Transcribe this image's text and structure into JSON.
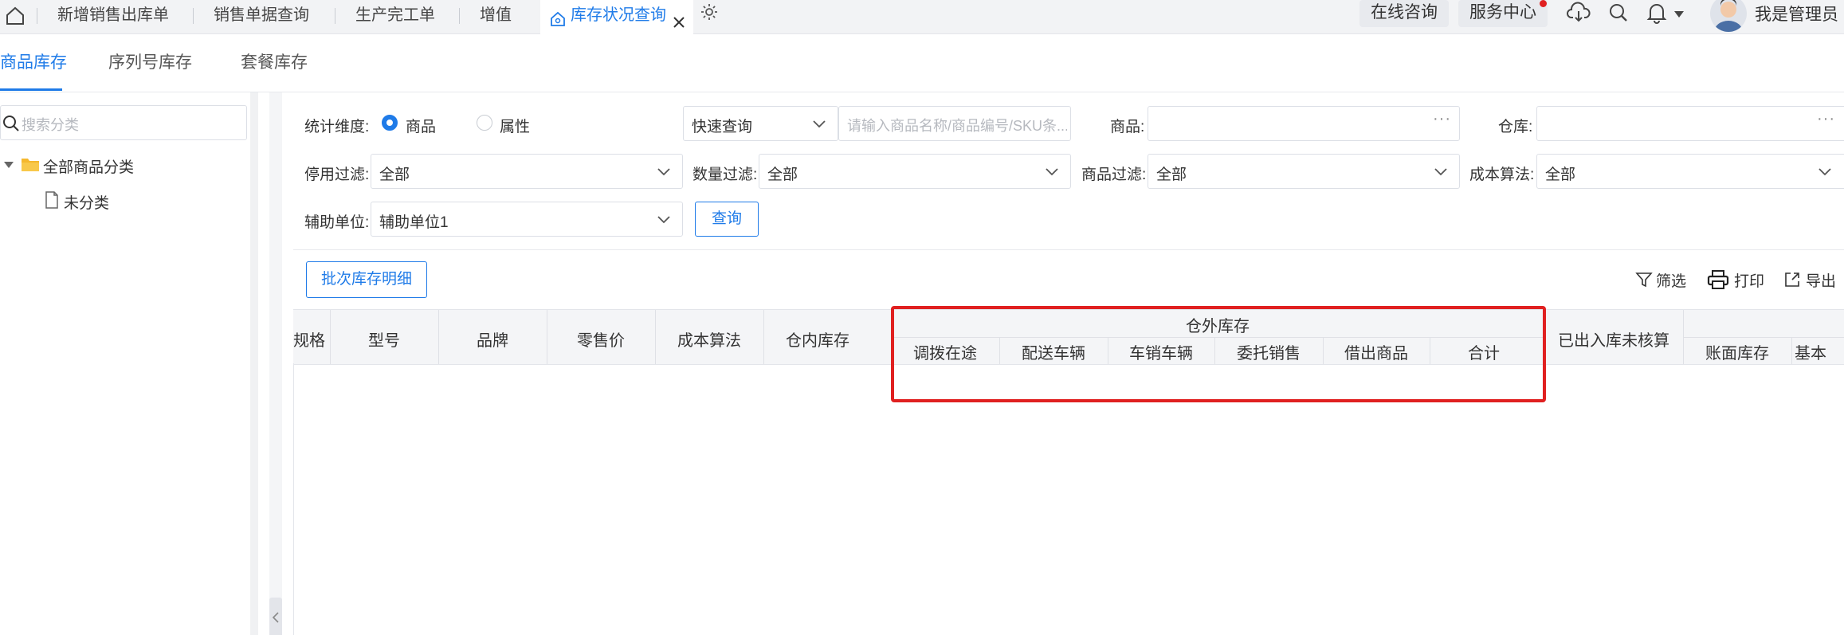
{
  "top_tabs": [
    {
      "label": "新增销售出库单"
    },
    {
      "label": "销售单据查询"
    },
    {
      "label": "生产完工单"
    },
    {
      "label": "增值"
    },
    {
      "label": "库存状况查询",
      "active": true
    }
  ],
  "top_right": {
    "online_consult": "在线咨询",
    "service_center": "服务中心",
    "user_name": "我是管理员"
  },
  "sub_tabs": [
    "商品库存",
    "序列号库存",
    "套餐库存"
  ],
  "left_panel": {
    "search_placeholder": "搜索分类",
    "tree": [
      {
        "label": "全部商品分类",
        "icon": "folder-icon"
      },
      {
        "label": "未分类",
        "icon": "file-icon"
      }
    ]
  },
  "filters": {
    "dimension_label": "统计维度:",
    "dimension_options": [
      {
        "label": "商品",
        "selected": true
      },
      {
        "label": "属性",
        "selected": false
      }
    ],
    "quick_query": "快速查询",
    "quick_query_placeholder": "请输入商品名称/商品编号/SKU条...",
    "product_label": "商品:",
    "warehouse_label": "仓库:",
    "disable_filter_label": "停用过滤:",
    "disable_filter_value": "全部",
    "qty_filter_label": "数量过滤:",
    "qty_filter_value": "全部",
    "product_filter_label": "商品过滤:",
    "product_filter_value": "全部",
    "cost_method_label": "成本算法:",
    "cost_method_value": "全部",
    "aux_unit_label": "辅助单位:",
    "aux_unit_value": "辅助单位1",
    "query_button": "查询"
  },
  "toolbar": {
    "batch_detail": "批次库存明细",
    "filter": "筛选",
    "print": "打印",
    "export": "导出"
  },
  "table": {
    "columns": [
      "规格",
      "型号",
      "品牌",
      "零售价",
      "成本算法",
      "仓内库存"
    ],
    "outside_group": "仓外库存",
    "outside_columns": [
      "调拨在途",
      "配送车辆",
      "车销车辆",
      "委托销售",
      "借出商品",
      "合计"
    ],
    "after_columns": [
      "已出入库未核算"
    ],
    "tail_columns": [
      "账面库存",
      "基本"
    ]
  },
  "colors": {
    "accent": "#1f7be8",
    "highlight": "#e02020",
    "notification_dot": "#e02020"
  }
}
